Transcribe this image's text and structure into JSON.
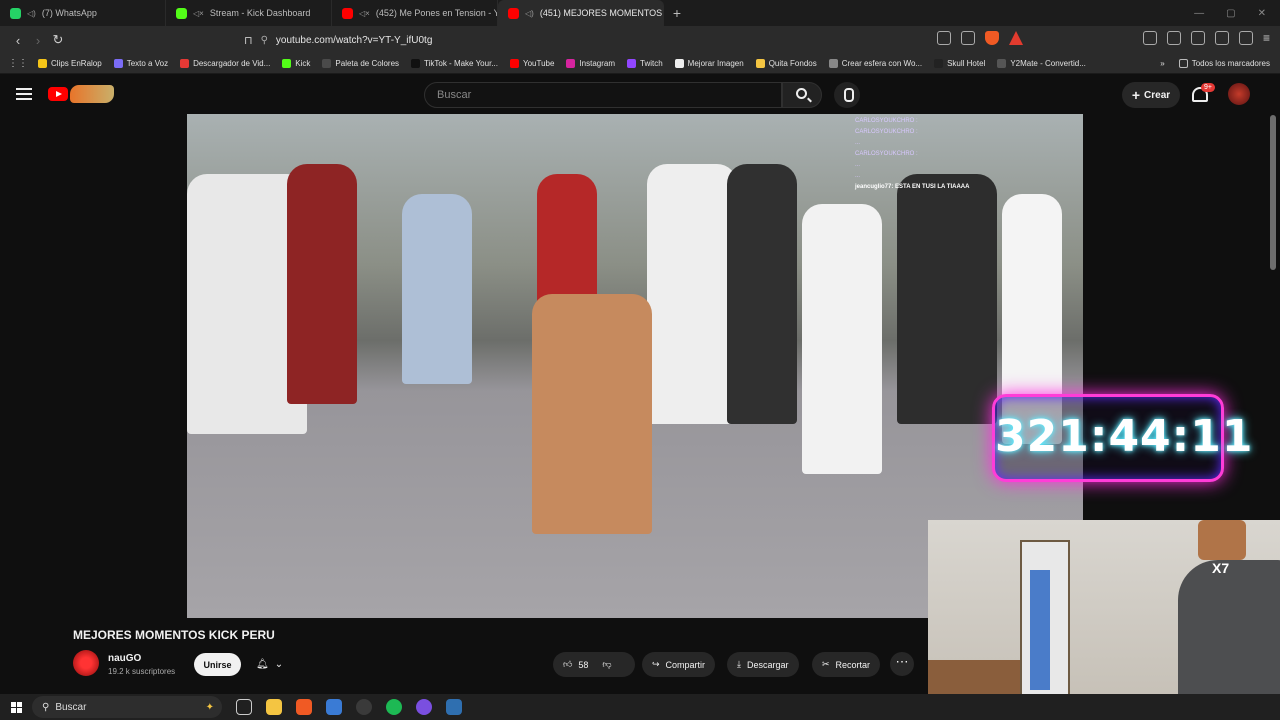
{
  "tabs": [
    {
      "label": "(7) WhatsApp",
      "color": "#25d366"
    },
    {
      "label": "Stream - Kick Dashboard",
      "color": "#53fc18"
    },
    {
      "label": "(452) Me Pones en Tension - You",
      "color": "#ff0000"
    },
    {
      "label": "(451) MEJORES MOMENTOS",
      "color": "#ff0000"
    }
  ],
  "address": {
    "url": "youtube.com/watch?v=YT-Y_ifU0tg"
  },
  "bookmarks": [
    {
      "label": "Clips EnRalop",
      "color": "#f5c518"
    },
    {
      "label": "Texto a Voz",
      "color": "#7b6cf6"
    },
    {
      "label": "Descargador de Vid...",
      "color": "#e53935"
    },
    {
      "label": "Kick",
      "color": "#53fc18"
    },
    {
      "label": "Paleta de Colores",
      "color": "#4a4a4a"
    },
    {
      "label": "TikTok - Make Your...",
      "color": "#111111"
    },
    {
      "label": "YouTube",
      "color": "#ff0000"
    },
    {
      "label": "Instagram",
      "color": "#d6249f"
    },
    {
      "label": "Twitch",
      "color": "#9146ff"
    },
    {
      "label": "Mejorar Imagen",
      "color": "#eeeeee"
    },
    {
      "label": "Quita Fondos",
      "color": "#f4c542"
    },
    {
      "label": "Crear esfera con Wo...",
      "color": "#888888"
    },
    {
      "label": "Skull Hotel",
      "color": "#222222"
    },
    {
      "label": "Y2Mate - Convertid...",
      "color": "#555555"
    }
  ],
  "bookmarks_all": "Todos los marcadores",
  "youtube": {
    "search_placeholder": "Buscar",
    "create_label": "Crear",
    "notif_count": "9+"
  },
  "video": {
    "title": "MEJORES MOMENTOS KICK PERU",
    "timer": "321:44:11",
    "chat": [
      "CARLOSYOUKCHRO :",
      "CARLOSYOUKCHRO :",
      "...",
      "CARLOSYOUKCHRO :",
      "...",
      "...",
      "jeancuglio77: ESTA EN TUSI LA TIAAAA"
    ],
    "emote_text": "X7",
    "channel_name": "nauGO",
    "subscribers": "19.2 k suscriptores",
    "join_label": "Unirse",
    "likes": "58",
    "share_label": "Compartir",
    "download_label": "Descargar",
    "clip_label": "Recortar"
  },
  "taskbar": {
    "search_placeholder": "Buscar"
  }
}
